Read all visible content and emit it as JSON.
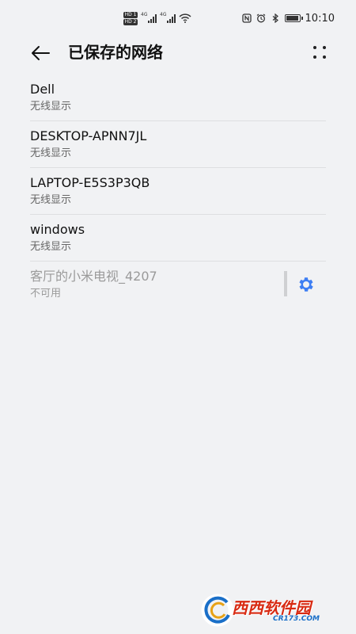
{
  "status_bar": {
    "time": "10:10",
    "sim1_badge": "HD 1",
    "sim2_badge": "HD 2",
    "signal1_tag": "4G",
    "signal2_tag": "4G",
    "icons": [
      "nfc-icon",
      "alarm-icon",
      "bluetooth-icon",
      "battery-icon"
    ]
  },
  "header": {
    "title": "已保存的网络",
    "back_icon": "arrow-left-icon",
    "more_icon": "more-dots-icon"
  },
  "networks": [
    {
      "name": "Dell",
      "status": "无线显示"
    },
    {
      "name": "DESKTOP-APNN7JL",
      "status": "无线显示"
    },
    {
      "name": "LAPTOP-E5S3P3QB",
      "status": "无线显示"
    },
    {
      "name": "windows",
      "status": "无线显示"
    },
    {
      "name": "客厅的小米电视_4207",
      "status": "不可用"
    }
  ],
  "watermark": {
    "text": "西西软件园",
    "sub": "CR173.COM"
  },
  "colors": {
    "background": "#f1f2f4",
    "accent": "#3d7ef3",
    "text_primary": "#111111",
    "text_secondary": "#666666",
    "text_disabled": "#9a9a9a"
  }
}
